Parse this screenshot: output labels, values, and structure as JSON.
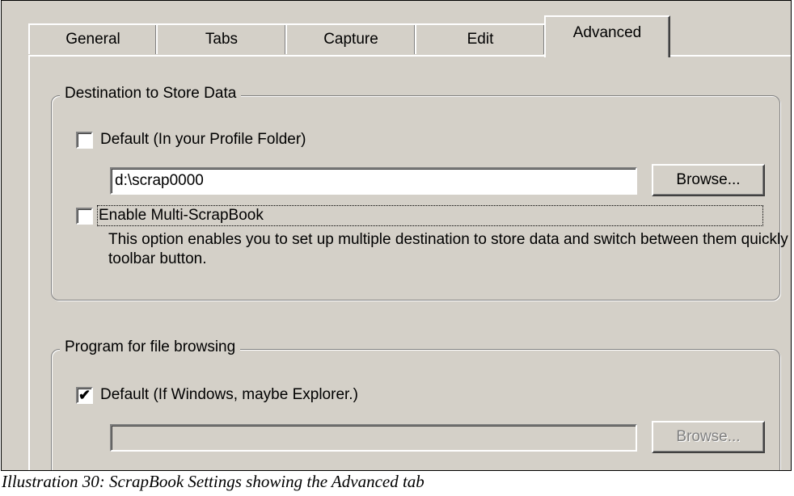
{
  "tabs": [
    {
      "label": "General",
      "active": false
    },
    {
      "label": "Tabs",
      "active": false
    },
    {
      "label": "Capture",
      "active": false
    },
    {
      "label": "Edit",
      "active": false
    },
    {
      "label": "Advanced",
      "active": true
    }
  ],
  "destination": {
    "title": "Destination to Store Data",
    "default_checkbox": {
      "label": "Default (In your Profile Folder)",
      "checked": false
    },
    "path_value": "d:\\scrap0000",
    "browse_label": "Browse...",
    "multi_checkbox": {
      "label": "Enable Multi-ScrapBook",
      "checked": false
    },
    "multi_description": "This option enables you to set up multiple destination to store data and switch between them quickly with toolbar button."
  },
  "program": {
    "title": "Program for file browsing",
    "default_checkbox": {
      "label": "Default (If Windows, maybe Explorer.)",
      "checked": true,
      "mark": "✔"
    },
    "path_value": "",
    "browse_label": "Browse..."
  },
  "caption": "Illustration 30: ScrapBook Settings showing the Advanced tab"
}
